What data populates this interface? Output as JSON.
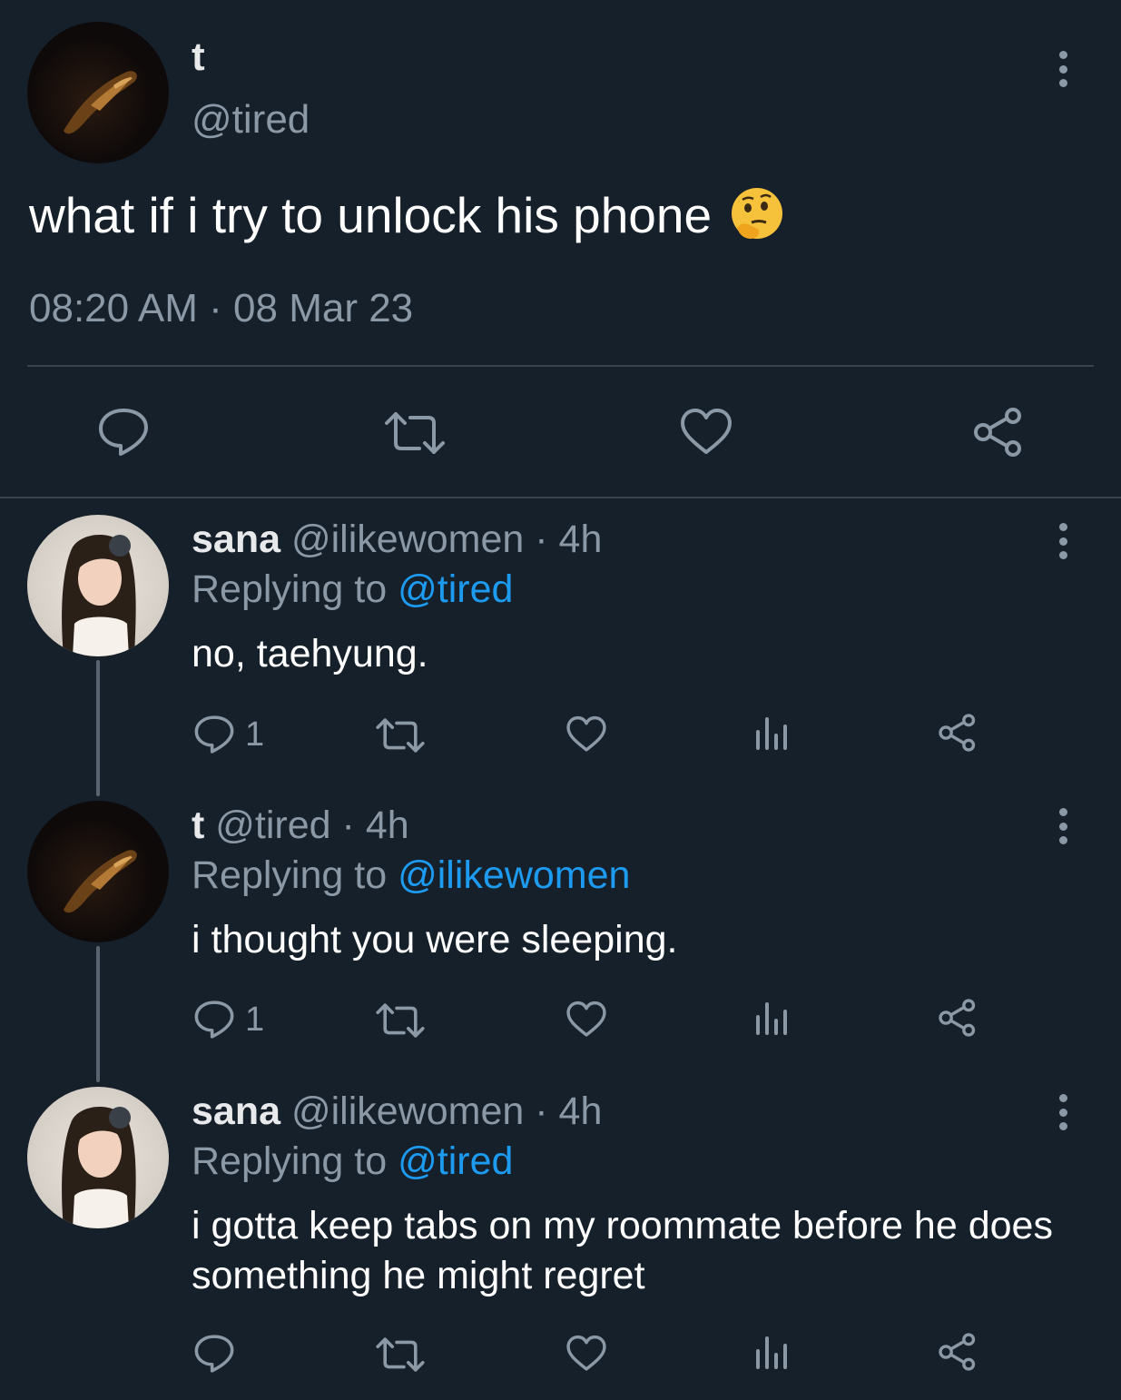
{
  "main_tweet": {
    "author_name": "t",
    "author_handle": "@tired",
    "text": "what if i try to unlock his phone",
    "emoji": "🤔",
    "time": "08:20 AM",
    "separator": "·",
    "date": "08 Mar 23",
    "actions": {
      "reply_icon": "reply-icon",
      "retweet_icon": "retweet-icon",
      "like_icon": "like-icon",
      "share_icon": "share-icon"
    }
  },
  "replies": [
    {
      "author_name": "sana",
      "author_handle": "@ilikewomen",
      "age": "· 4h",
      "replying_prefix": "Replying to",
      "replying_to": "@tired",
      "text": "no, taehyung.",
      "reply_count": "1"
    },
    {
      "author_name": "t",
      "author_handle": "@tired",
      "age": "· 4h",
      "replying_prefix": "Replying to",
      "replying_to": "@ilikewomen",
      "text": "i thought you were sleeping.",
      "reply_count": "1"
    },
    {
      "author_name": "sana",
      "author_handle": "@ilikewomen",
      "age": "· 4h",
      "replying_prefix": "Replying to",
      "replying_to": "@tired",
      "text": "i gotta keep tabs on my roommate before he does something he might regret",
      "reply_count": ""
    }
  ],
  "colors": {
    "background": "#16202b",
    "accent": "#1d9bf0",
    "muted": "#8b98a5",
    "text": "#ffffff"
  }
}
